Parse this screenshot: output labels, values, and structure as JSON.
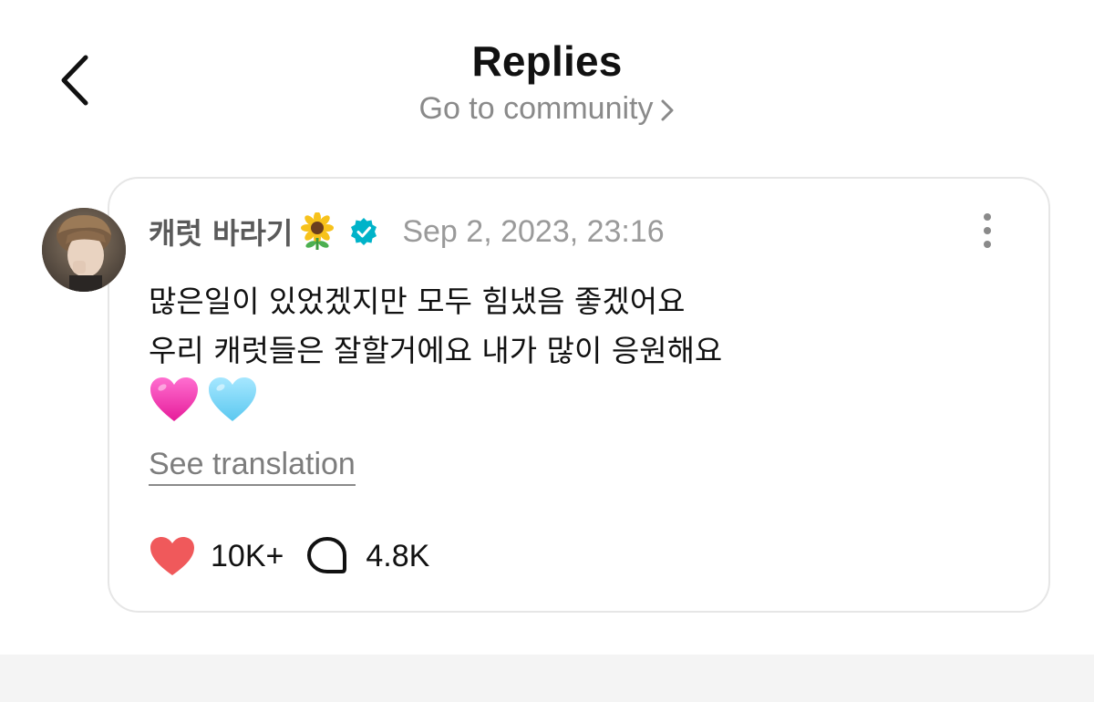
{
  "header": {
    "title": "Replies",
    "community_link": "Go to community",
    "back_icon": "chevron-left-icon"
  },
  "post": {
    "author": "캐럿 바라기",
    "author_emoji": "sunflower-icon",
    "verified_icon": "verified-badge-icon",
    "timestamp": "Sep 2, 2023, 23:16",
    "lines": [
      "많은일이 있었겠지만 모두 힘냈음 좋겠어요",
      "우리 캐럿들은 잘할거에요 내가 많이 응원해요"
    ],
    "emojis": [
      "pink-heart-icon",
      "light-blue-heart-icon"
    ],
    "see_translation": "See translation",
    "likes": "10K+",
    "replies": "4.8K"
  },
  "colors": {
    "verified": "#00b3c9",
    "like": "#f0595b",
    "pink_heart": "#ff3fb4",
    "blue_heart": "#7fd7f7",
    "muted_text": "#9a9a9a"
  }
}
